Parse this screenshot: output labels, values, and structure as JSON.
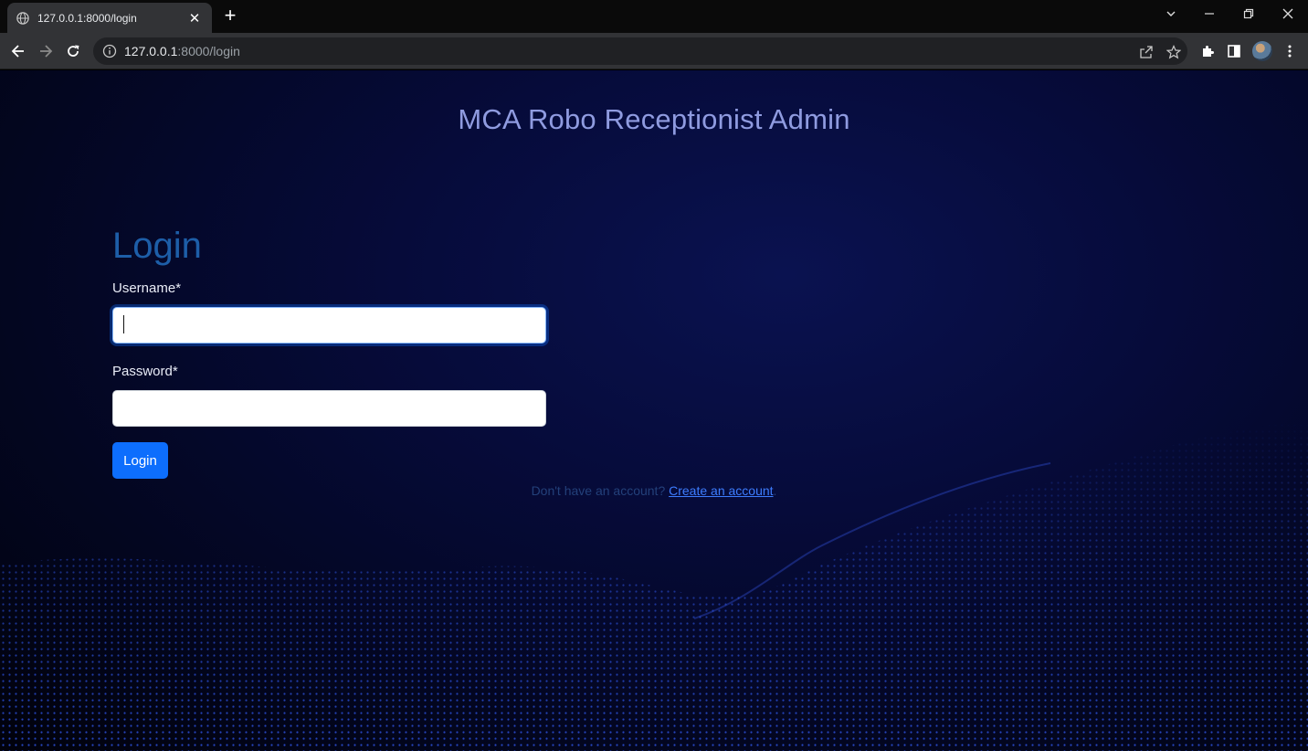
{
  "browser": {
    "tab_title": "127.0.0.1:8000/login",
    "tab_close": "✕",
    "new_tab": "+",
    "url_host": "127.0.0.1",
    "url_rest": ":8000/login"
  },
  "page": {
    "app_title": "MCA Robo Receptionist Admin",
    "heading": "Login",
    "username_label": "Username*",
    "username_value": "",
    "password_label": "Password*",
    "password_value": "",
    "login_button": "Login",
    "signup_prompt": "Don't have an account?",
    "signup_link": "Create an account",
    "signup_suffix": "."
  },
  "colors": {
    "accent": "#0d6efd",
    "title": "#8f9be0",
    "heading": "#1d5ea8",
    "background": "#060b3a"
  }
}
